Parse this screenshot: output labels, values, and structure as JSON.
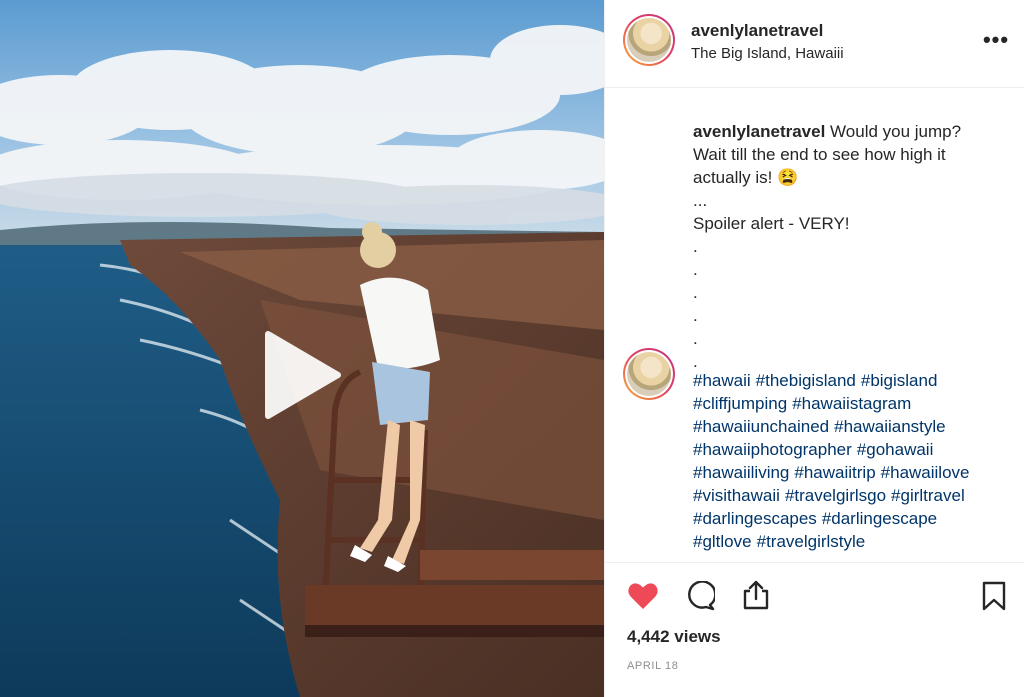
{
  "post": {
    "username": "avenlylanetravel",
    "location": "The Big Island, Hawaiii",
    "caption_lines": [
      "Would you jump?",
      "Wait till the end to see how high it",
      "actually is! 😫",
      "...",
      "Spoiler alert - VERY!",
      ".",
      ".",
      ".",
      ".",
      ".",
      "."
    ],
    "hashtags": [
      "#hawaii",
      "#thebigisland",
      "#bigisland",
      "#cliffjumping",
      "#hawaiistagram",
      "#hawaiiunchained",
      "#hawaiianstyle",
      "#hawaiiphotographer",
      "#gohawaii",
      "#hawaiiliving",
      "#hawaiitrip",
      "#hawaiilove",
      "#visithawaii",
      "#travelgirlsgo",
      "#girltravel",
      "#darlingescapes",
      "#darlingescape",
      "#gltlove",
      "#travelgirlstyle"
    ],
    "views": "4,442 views",
    "date": "April 18"
  },
  "icons": {
    "more": "more-options-icon",
    "like": "heart-icon",
    "comment": "comment-icon",
    "share": "share-icon",
    "save": "bookmark-icon",
    "play": "play-icon"
  },
  "colors": {
    "like": "#ed4956",
    "hashtag": "#003569",
    "text": "#262626",
    "muted": "#8e8e8e"
  }
}
